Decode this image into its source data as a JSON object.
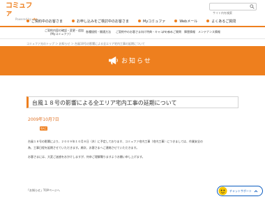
{
  "header": {
    "logo_text": "コミュファ",
    "logo_sub_prefix": "Powered by",
    "logo_sub_brand": "ctc",
    "search_placeholder": "サイト内を検索"
  },
  "mainnav": {
    "items": [
      {
        "label": "ご契約中のお客さま"
      },
      {
        "label": "お申し込みをご検討中のお客さま"
      },
      {
        "label": "Myコミュファ"
      },
      {
        "label": "Webメール"
      },
      {
        "label": "よくあるご質問"
      }
    ]
  },
  "subnav": {
    "items": [
      {
        "line1": "ご契約内容の確認・変更・追加",
        "line2": "(Myコミュファ)"
      },
      {
        "line1": "各種接続・開通方法",
        "line2": ""
      },
      {
        "line1": "ご契約中のお客さま向け特典・キャンペーン",
        "line2": ""
      },
      {
        "line1": "よくあるご質問",
        "line2": ""
      },
      {
        "line1": "障害情報",
        "line2": ""
      },
      {
        "line1": "メンテナンス情報",
        "line2": ""
      }
    ]
  },
  "breadcrumb": "コミュファ光のトップ ＞ お知らせ ＞ 台風18号の影響による全エリア宅内工事の延期について",
  "banner": {
    "title": "お知らせ"
  },
  "news": {
    "title": "台風１８号の影響による全エリア宅内工事の延期について",
    "date": "2009年10月7日",
    "tag": "宅内工事",
    "paragraphs": [
      "台風１８号の影響により、２００９年１０月８日（木）に予定しております、コミュファ宅内工事（宅内工事）につきましては、作業安全の",
      "為、工事日程を延期させていただきます。順次、お客さまへご連絡させていただきます。",
      "お客さまには、大変ご迷惑をおかけしますが、何卒ご理解賜りますようお願い申し上げます。"
    ]
  },
  "bottom_links": [
    "「お知らせ」TOPページへ"
  ],
  "chatbot": {
    "label": "チャットサポート"
  },
  "colors": {
    "brand_orange": "#ee7f1e",
    "date_orange": "#e07022",
    "chatbot_blue": "#0a5bbf"
  }
}
